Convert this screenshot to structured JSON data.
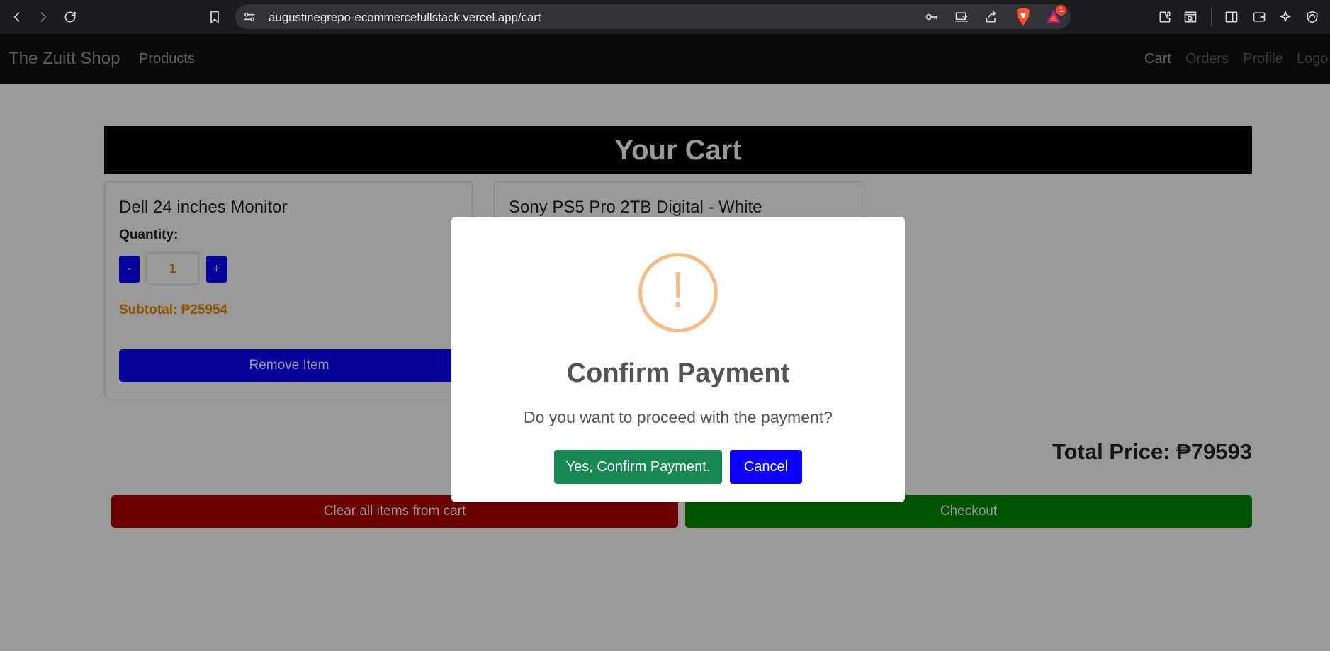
{
  "browser": {
    "url": "augustinegrepo-ecommercefullstack.vercel.app/cart",
    "rewards_badge": "1",
    "icons": [
      "back-icon",
      "forward-icon",
      "reload-icon",
      "bookmark-icon",
      "site-settings-icon",
      "key-icon",
      "install-app-icon",
      "share-icon",
      "brave-shields-icon",
      "brave-rewards-icon",
      "extensions-icon",
      "reader-mode-icon",
      "sidebar-icon",
      "wallet-icon",
      "leo-ai-icon",
      "vpn-icon"
    ]
  },
  "navbar": {
    "brand": "The Zuitt Shop",
    "products": "Products",
    "cart": "Cart",
    "orders": "Orders",
    "profile": "Profile",
    "logout": "Logo"
  },
  "cart": {
    "header": "Your Cart",
    "items": [
      {
        "name": "Dell 24 inches Monitor",
        "quantity_label": "Quantity:",
        "minus": "-",
        "quantity": "1",
        "plus": "+",
        "subtotal": "Subtotal: ₱25954",
        "remove": "Remove Item"
      },
      {
        "name": "Sony PS5 Pro 2TB Digital - White"
      }
    ],
    "total": "Total Price: ₱79593",
    "clear": "Clear all items from cart",
    "checkout": "Checkout"
  },
  "modal": {
    "icon": "!",
    "title": "Confirm Payment",
    "text": "Do you want to proceed with the payment?",
    "confirm": "Yes, Confirm Payment.",
    "cancel": "Cancel"
  },
  "colors": {
    "primary_blue": "#0d00ff",
    "subtotal_orange": "#f28c00",
    "danger_red": "#b30000",
    "checkout_green": "#008a00",
    "confirm_green": "#198754",
    "warning_icon": "#f8bb86"
  }
}
